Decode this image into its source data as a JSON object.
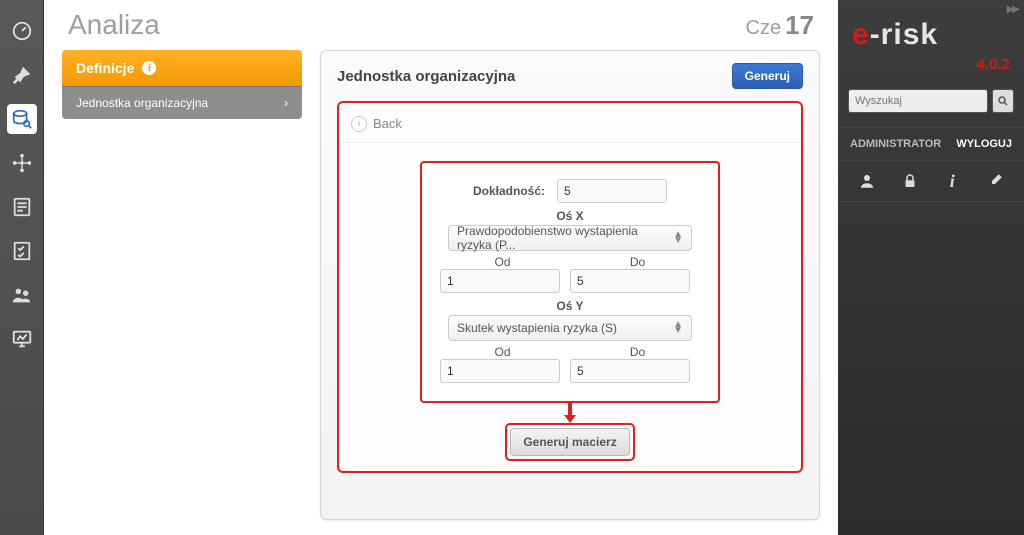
{
  "header": {
    "title": "Analiza",
    "date_month": "Cze",
    "date_day": "17"
  },
  "sidenav": {
    "head_label": "Definicje",
    "items": [
      {
        "label": "Jednostka organizacyjna"
      }
    ]
  },
  "panel": {
    "title": "Jednostka organizacyjna",
    "generate_label": "Generuj",
    "back_label": "Back",
    "form": {
      "accuracy_label": "Dokładność:",
      "accuracy_value": "5",
      "axis_x_label": "Oś X",
      "axis_x_select": "Prawdopodobienstwo wystapienia ryzyka (P...",
      "from_label": "Od",
      "to_label": "Do",
      "x_from": "1",
      "x_to": "5",
      "axis_y_label": "Oś Y",
      "axis_y_select": "Skutek wystapienia ryzyka (S)",
      "y_from": "1",
      "y_to": "5",
      "generate_matrix_label": "Generuj macierz"
    }
  },
  "right": {
    "brand_e": "e",
    "brand_rest": "-risk",
    "version": "4.0.2",
    "search_placeholder": "Wyszukaj",
    "user": "ADMINISTRATOR",
    "logout": "WYLOGUJ"
  }
}
